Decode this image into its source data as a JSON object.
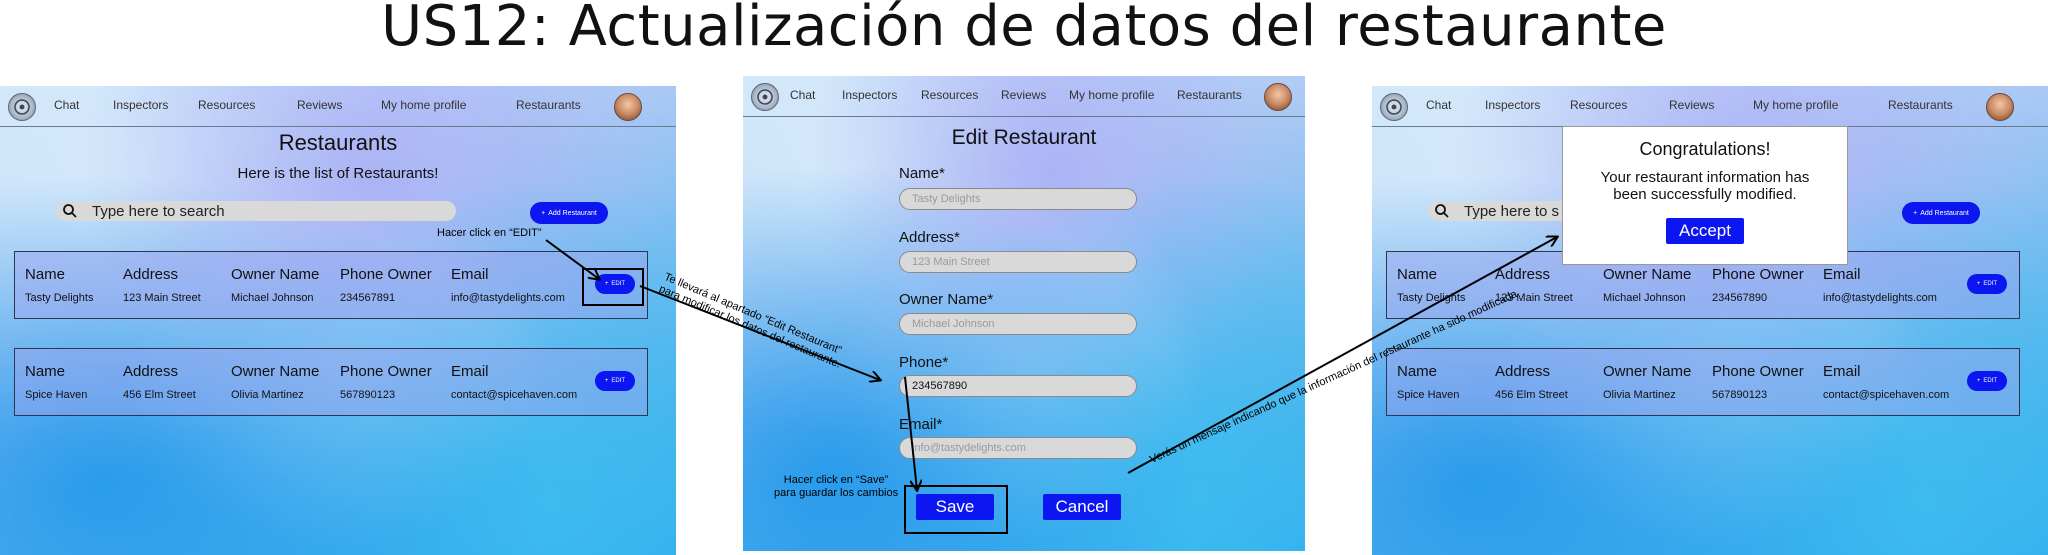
{
  "page_title": "US12: Actualización de datos del restaurante",
  "nav": {
    "items": [
      "Chat",
      "Inspectors",
      "Resources",
      "Reviews",
      "My home profile",
      "Restaurants"
    ]
  },
  "list_screen": {
    "heading": "Restaurants",
    "subheading": "Here is the list of Restaurants!",
    "search_placeholder": "Type here to search",
    "add_button": "Add Restaurant",
    "columns": [
      "Name",
      "Address",
      "Owner Name",
      "Phone Owner",
      "Email"
    ],
    "rows": [
      [
        "Tasty Delights",
        "123 Main Street",
        "Michael Johnson",
        "234567891",
        "info@tastydelights.com"
      ],
      [
        "Spice Haven",
        "456 Elm Street",
        "Olivia Martinez",
        "567890123",
        "contact@spicehaven.com"
      ]
    ],
    "edit_label": "EDIT"
  },
  "edit_screen": {
    "heading": "Edit Restaurant",
    "fields": [
      {
        "label": "Name*",
        "value": "Tasty Delights",
        "placeholder": true
      },
      {
        "label": "Address*",
        "value": "123 Main Street",
        "placeholder": true
      },
      {
        "label": "Owner Name*",
        "value": "Michael Johnson",
        "placeholder": true
      },
      {
        "label": "Phone*",
        "value": "234567890",
        "placeholder": false
      },
      {
        "label": "Email*",
        "value": "info@tastydelights.com",
        "placeholder": true
      }
    ],
    "save_label": "Save",
    "cancel_label": "Cancel"
  },
  "result_screen": {
    "search_partial": "Type here to s",
    "add_button": "Add Restaurant",
    "rows": [
      [
        "Tasty Delights",
        "123 Main Street",
        "Michael Johnson",
        "234567890",
        "info@tastydelights.com"
      ],
      [
        "Spice Haven",
        "456 Elm Street",
        "Olivia Martinez",
        "567890123",
        "contact@spicehaven.com"
      ]
    ],
    "modal": {
      "title": "Congratulations!",
      "message_line1": "Your restaurant information has",
      "message_line2": "been successfully modified.",
      "accept_label": "Accept"
    }
  },
  "annotations": {
    "click_edit": "Hacer click en “EDIT”",
    "go_edit_line1": "Te llevará al apartado “Edit Restaurant”",
    "go_edit_line2": "para modificar los datos del restaurante.",
    "click_save_line1": "Hacer click en “Save”",
    "click_save_line2": "para guardar los cambios",
    "message_note": "Verás un mensaje indicando que la información del restaurante ha sido modificada"
  },
  "colors": {
    "primary_button": "#0b16f0",
    "card_fill": "#a0a5f0",
    "field_fill": "#d9d9d9"
  }
}
